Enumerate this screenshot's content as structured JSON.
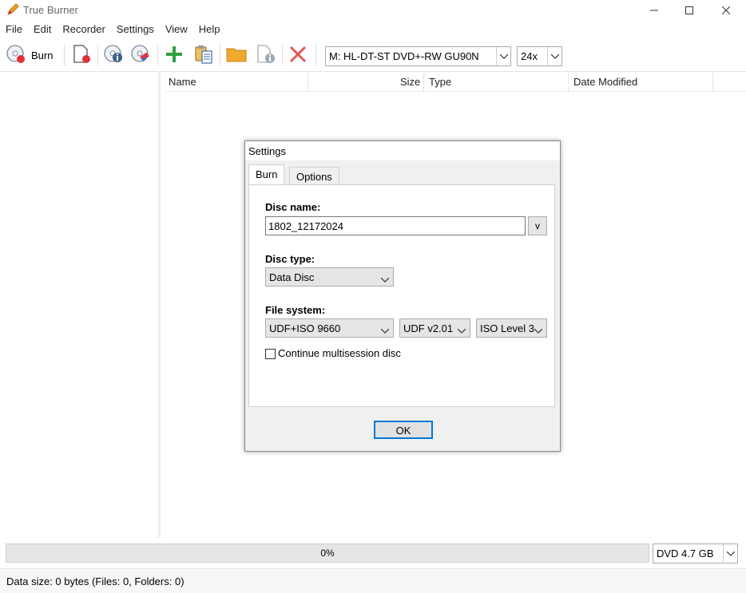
{
  "window": {
    "title": "True Burner"
  },
  "menu": [
    "File",
    "Edit",
    "Recorder",
    "Settings",
    "View",
    "Help"
  ],
  "toolbar": {
    "burn_label": "Burn",
    "drive": "M: HL-DT-ST DVD+-RW GU90N",
    "speed": "24x"
  },
  "columns": {
    "name": "Name",
    "size": "Size",
    "type": "Type",
    "date_modified": "Date Modified"
  },
  "progress": {
    "text": "0%",
    "fraction": 0
  },
  "capacity": "DVD 4.7 GB",
  "status": "Data size: 0 bytes (Files: 0, Folders: 0)",
  "dialog": {
    "title": "Settings",
    "tabs": [
      "Burn",
      "Options"
    ],
    "disc_name_label": "Disc name:",
    "disc_name_value": "1802_12172024",
    "v_button": "v",
    "disc_type_label": "Disc type:",
    "disc_type_value": "Data Disc",
    "file_system_label": "File system:",
    "file_system_value": "UDF+ISO 9660",
    "udf_version": "UDF v2.01",
    "iso_level": "ISO Level 3",
    "multisession_label": "Continue multisession disc",
    "multisession_checked": false,
    "ok_label": "OK"
  },
  "colors": {
    "accent": "#0078d7",
    "burn_red": "#e0303a",
    "add_green": "#2ea043",
    "folder": "#f0a830",
    "delete_red": "#e05a5a"
  }
}
